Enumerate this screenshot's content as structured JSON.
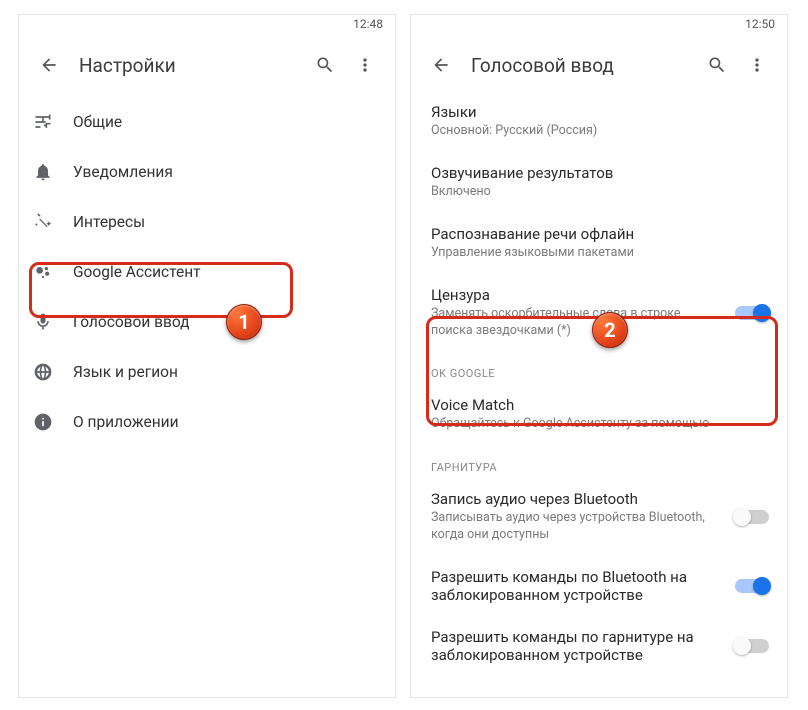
{
  "left": {
    "time": "12:48",
    "title": "Настройки",
    "items": [
      {
        "icon": "sliders",
        "label": "Общие"
      },
      {
        "icon": "bell",
        "label": "Уведомления"
      },
      {
        "icon": "wand",
        "label": "Интересы"
      },
      {
        "icon": "assistant",
        "label": "Google Ассистент"
      },
      {
        "icon": "mic",
        "label": "Голосовой ввод"
      },
      {
        "icon": "globe",
        "label": "Язык и регион"
      },
      {
        "icon": "info",
        "label": "О приложении"
      }
    ]
  },
  "right": {
    "time": "12:50",
    "title": "Голосовой ввод",
    "settings_top": [
      {
        "primary": "Языки",
        "secondary": "Основной: Русский (Россия)"
      },
      {
        "primary": "Озвучивание результатов",
        "secondary": "Включено"
      },
      {
        "primary": "Распознавание речи офлайн",
        "secondary": "Управление языковыми пакетами"
      },
      {
        "primary": "Цензура",
        "secondary": "Заменять оскорбительные слова в строке поиска звездочками (*)",
        "toggle": "on"
      }
    ],
    "section_okgoogle": "OK GOOGLE",
    "voice_match": {
      "primary": "Voice Match",
      "secondary": "Обращайтесь к Google Ассистенту за помощью"
    },
    "section_headset": "ГАРНИТУРА",
    "settings_bottom": [
      {
        "primary": "Запись аудио через Bluetooth",
        "secondary": "Записывать аудио через устройства Bluetooth, когда они доступны",
        "toggle": "off"
      },
      {
        "primary": "Разрешить команды по Bluetooth на заблокированном устройстве",
        "toggle": "on"
      },
      {
        "primary": "Разрешить команды по гарнитуре на заблокированном устройстве",
        "toggle": "off"
      }
    ]
  },
  "badges": {
    "one": "1",
    "two": "2"
  }
}
